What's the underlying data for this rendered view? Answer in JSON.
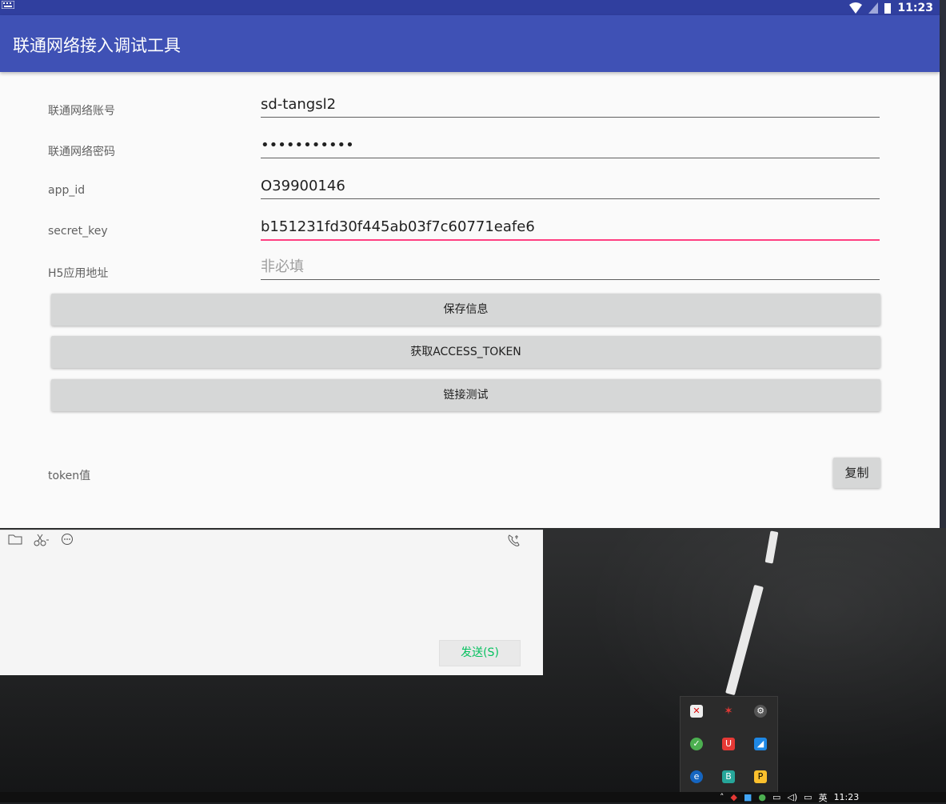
{
  "statusbar": {
    "time": "11:23"
  },
  "app": {
    "title": "联通网络接入调试工具"
  },
  "form": {
    "rows": [
      {
        "label": "联通网络账号",
        "value": "sd-tangsl2"
      },
      {
        "label": "联通网络密码",
        "value": "•••••••••••"
      },
      {
        "label": "app_id",
        "value": "O39900146"
      },
      {
        "label": "secret_key",
        "value": "b151231fd30f445ab03f7c60771eafe6"
      },
      {
        "label": "H5应用地址",
        "placeholder": "非必填"
      }
    ]
  },
  "buttons": {
    "save": "保存信息",
    "get_token": "获取ACCESS_TOKEN",
    "link_test": "链接测试",
    "copy": "复制"
  },
  "token": {
    "label": "token值"
  },
  "chat": {
    "send_label": "发送(S)"
  },
  "taskbar": {
    "time": "11:23",
    "ime": "英"
  },
  "colors": {
    "primary": "#3f51b5",
    "primary_dark": "#303f9f",
    "accent": "#ff4081",
    "send_green": "#07c160"
  }
}
